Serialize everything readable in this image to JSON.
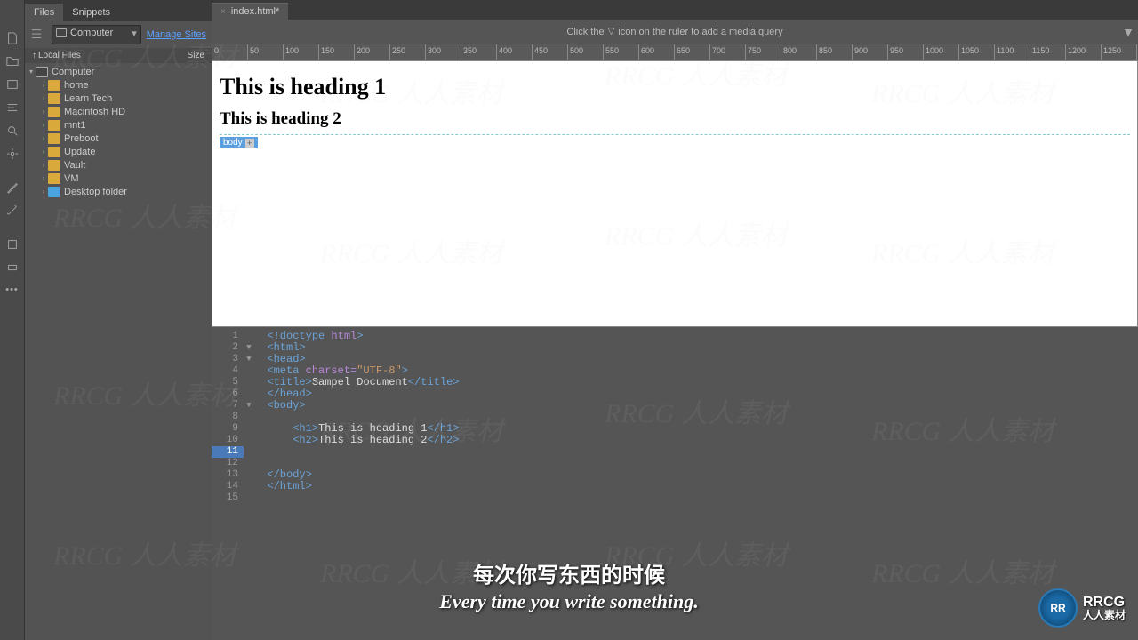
{
  "panel": {
    "tabs": [
      "Files",
      "Snippets"
    ],
    "selector": "Computer",
    "manage": "Manage Sites",
    "colLocal": "Local Files",
    "colSize": "Size",
    "root": "Computer",
    "items": [
      {
        "label": "home",
        "color": "yellow"
      },
      {
        "label": "Learn Tech",
        "color": "yellow"
      },
      {
        "label": "Macintosh HD",
        "color": "yellow"
      },
      {
        "label": "mnt1",
        "color": "yellow"
      },
      {
        "label": "Preboot",
        "color": "yellow"
      },
      {
        "label": "Update",
        "color": "yellow"
      },
      {
        "label": "Vault",
        "color": "yellow"
      },
      {
        "label": "VM",
        "color": "yellow"
      },
      {
        "label": "Desktop folder",
        "color": "blue"
      }
    ]
  },
  "doc": {
    "tab": "index.html*"
  },
  "hint": {
    "pre": "Click the",
    "post": "icon on the ruler to add a media query"
  },
  "ruler_step": 50,
  "ruler_max": 1350,
  "preview": {
    "h1": "This is heading 1",
    "h2": "This is heading 2",
    "badge": "body"
  },
  "code": [
    {
      "n": 1,
      "fold": "",
      "html": "<span class='tag'>&lt;!doctype</span> <span class='attr'>html</span><span class='tag'>&gt;</span>"
    },
    {
      "n": 2,
      "fold": "▼",
      "html": "<span class='tag'>&lt;html&gt;</span>"
    },
    {
      "n": 3,
      "fold": "▼",
      "html": "<span class='tag'>&lt;head&gt;</span>"
    },
    {
      "n": 4,
      "fold": "",
      "html": "<span class='tag'>&lt;meta</span> <span class='attr'>charset=</span><span class='str'>\"UTF-8\"</span><span class='tag'>&gt;</span>"
    },
    {
      "n": 5,
      "fold": "",
      "html": "<span class='tag'>&lt;title&gt;</span><span class='txt'>Sampel Document</span><span class='tag'>&lt;/title&gt;</span>"
    },
    {
      "n": 6,
      "fold": "",
      "html": "<span class='tag'>&lt;/head&gt;</span>"
    },
    {
      "n": 7,
      "fold": "▼",
      "html": "<span class='tag'>&lt;body&gt;</span>"
    },
    {
      "n": 8,
      "fold": "",
      "html": ""
    },
    {
      "n": 9,
      "fold": "",
      "html": "    <span class='tag'>&lt;h1&gt;</span><span class='txt'>This is heading 1</span><span class='tag'>&lt;/h1&gt;</span>"
    },
    {
      "n": 10,
      "fold": "",
      "html": "    <span class='tag'>&lt;h2&gt;</span><span class='txt'>This is heading 2</span><span class='tag'>&lt;/h2&gt;</span>"
    },
    {
      "n": 11,
      "fold": "",
      "html": "",
      "hl": true
    },
    {
      "n": 12,
      "fold": "",
      "html": ""
    },
    {
      "n": 13,
      "fold": "",
      "html": "<span class='tag'>&lt;/body&gt;</span>"
    },
    {
      "n": 14,
      "fold": "",
      "html": "<span class='tag'>&lt;/html&gt;</span>"
    },
    {
      "n": 15,
      "fold": "",
      "html": ""
    }
  ],
  "subtitle": {
    "cn": "每次你写东西的时候",
    "en": "Every time you write something."
  },
  "logo": {
    "badge": "RR",
    "text_top": "RRCG",
    "text_bottom": "人人素材"
  },
  "wm": "RRCG 人人素材"
}
